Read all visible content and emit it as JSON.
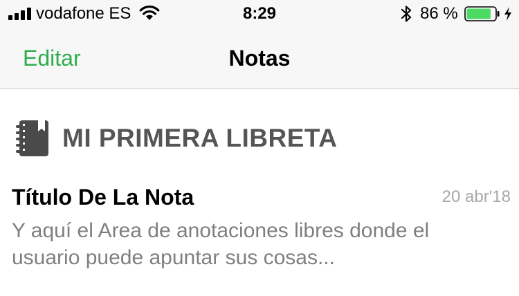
{
  "status_bar": {
    "carrier": "vodafone ES",
    "time": "8:29",
    "battery_percent": "86 %",
    "battery_level": 0.86,
    "icons": [
      "signal-icon",
      "wifi-icon",
      "bluetooth-icon",
      "battery-icon",
      "charging-icon"
    ]
  },
  "nav": {
    "edit_label": "Editar",
    "title": "Notas"
  },
  "notebook": {
    "title": "MI PRIMERA LIBRETA",
    "icon": "notebook-icon"
  },
  "notes": [
    {
      "title": "Título De La Nota",
      "date": "20 abr'18",
      "preview_line1": "Y aquí el Area de anotaciones libres donde el",
      "preview_line2": "usuario puede apuntar sus cosas..."
    }
  ],
  "colors": {
    "accent": "#2fae4f",
    "battery_fill": "#4cd964",
    "topbar_bg": "#f7f7f7",
    "section_title": "#555555",
    "date_text": "#a8a8a8",
    "preview_text": "#7f7f7f"
  }
}
